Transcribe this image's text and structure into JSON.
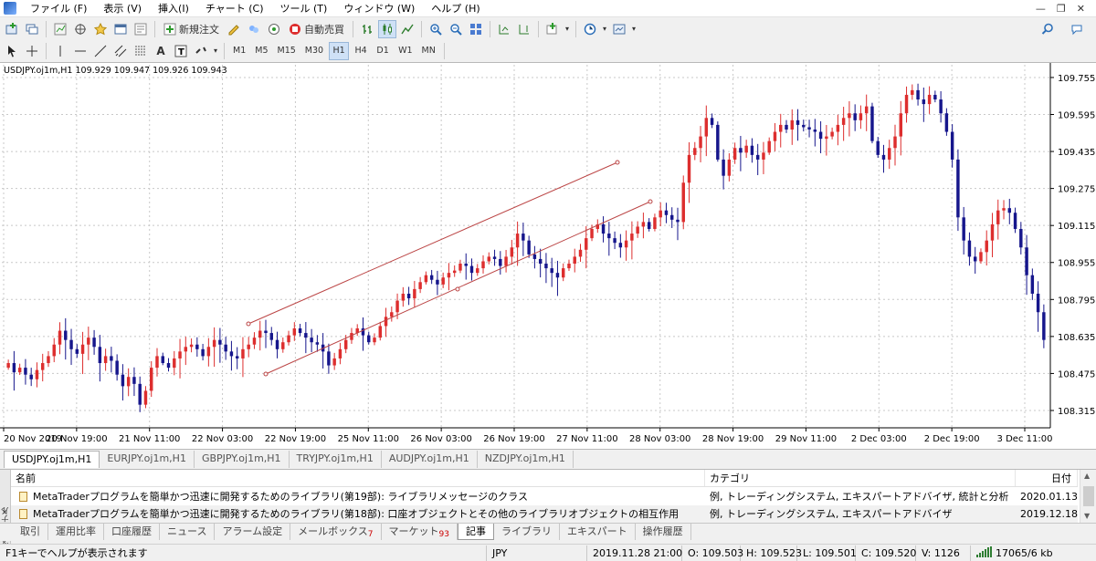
{
  "menu": [
    "ファイル (F)",
    "表示 (V)",
    "挿入(I)",
    "チャート (C)",
    "ツール (T)",
    "ウィンドウ (W)",
    "ヘルプ (H)"
  ],
  "toolbar": {
    "new_order": "新規注文",
    "auto_trade": "自動売買"
  },
  "timeframes": [
    "M1",
    "M5",
    "M15",
    "M30",
    "H1",
    "H4",
    "D1",
    "W1",
    "MN"
  ],
  "active_timeframe": "H1",
  "chart": {
    "label": "USDJPY.oj1m,H1  109.929 109.947 109.926 109.943"
  },
  "chart_data": {
    "type": "candlestick",
    "symbol": "USDJPY.oj1m",
    "timeframe": "H1",
    "ohlc_header": [
      109.929,
      109.947,
      109.926,
      109.943
    ],
    "y_ticks": [
      109.755,
      109.595,
      109.435,
      109.275,
      109.115,
      108.955,
      108.795,
      108.635,
      108.475,
      108.315
    ],
    "x_ticks": [
      "20 Nov 2019",
      "20 Nov 19:00",
      "21 Nov 11:00",
      "22 Nov 03:00",
      "22 Nov 19:00",
      "25 Nov 11:00",
      "26 Nov 03:00",
      "26 Nov 19:00",
      "27 Nov 11:00",
      "28 Nov 03:00",
      "28 Nov 19:00",
      "29 Nov 11:00",
      "2 Dec 03:00",
      "2 Dec 19:00",
      "3 Dec 11:00"
    ],
    "ylim": [
      108.24,
      109.81
    ],
    "bull_color": "#dd2e2e",
    "bear_color": "#16168c",
    "closes": [
      108.52,
      108.48,
      108.5,
      108.47,
      108.45,
      108.49,
      108.52,
      108.55,
      108.6,
      108.66,
      108.62,
      108.58,
      108.56,
      108.6,
      108.63,
      108.59,
      108.52,
      108.55,
      108.53,
      108.47,
      108.42,
      108.46,
      108.43,
      108.34,
      108.4,
      108.5,
      108.55,
      108.52,
      108.5,
      108.54,
      108.57,
      108.59,
      108.6,
      108.58,
      108.55,
      108.59,
      108.62,
      108.6,
      108.57,
      108.55,
      108.54,
      108.58,
      108.6,
      108.63,
      108.66,
      108.65,
      108.62,
      108.58,
      108.61,
      108.64,
      108.67,
      108.65,
      108.63,
      108.61,
      108.6,
      108.57,
      108.51,
      108.54,
      108.58,
      108.62,
      108.65,
      108.67,
      108.64,
      108.61,
      108.63,
      108.68,
      108.72,
      108.74,
      108.79,
      108.82,
      108.8,
      108.84,
      108.87,
      108.9,
      108.88,
      108.86,
      108.89,
      108.91,
      108.92,
      108.95,
      108.94,
      108.91,
      108.93,
      108.96,
      108.98,
      108.97,
      108.94,
      108.98,
      109.02,
      109.08,
      109.05,
      108.99,
      108.97,
      108.95,
      108.93,
      108.91,
      108.89,
      108.93,
      108.95,
      108.98,
      109.01,
      109.06,
      109.1,
      109.12,
      109.08,
      109.06,
      109.04,
      109.02,
      109.05,
      109.08,
      109.11,
      109.13,
      109.1,
      109.15,
      109.18,
      109.16,
      109.14,
      109.13,
      109.3,
      109.42,
      109.45,
      109.5,
      109.58,
      109.55,
      109.4,
      109.33,
      109.4,
      109.45,
      109.43,
      109.46,
      109.42,
      109.4,
      109.43,
      109.48,
      109.52,
      109.55,
      109.53,
      109.57,
      109.55,
      109.54,
      109.53,
      109.52,
      109.49,
      109.5,
      109.52,
      109.55,
      109.58,
      109.6,
      109.57,
      109.6,
      109.63,
      109.48,
      109.42,
      109.4,
      109.45,
      109.5,
      109.6,
      109.68,
      109.7,
      109.66,
      109.64,
      109.68,
      109.66,
      109.6,
      109.52,
      109.4,
      109.15,
      109.05,
      108.98,
      108.96,
      109.0,
      109.05,
      109.12,
      109.18,
      109.19,
      109.17,
      109.1,
      109.02,
      108.9,
      108.82,
      108.74,
      108.62
    ]
  },
  "symbol_tabs": [
    "USDJPY.oj1m,H1",
    "EURJPY.oj1m,H1",
    "GBPJPY.oj1m,H1",
    "TRYJPY.oj1m,H1",
    "AUDJPY.oj1m,H1",
    "NZDJPY.oj1m,H1"
  ],
  "active_symbol_tab": 0,
  "terminal": {
    "side_label": "ターミナル",
    "columns": [
      "名前",
      "カテゴリ",
      "日付"
    ],
    "rows": [
      {
        "name": "MetaTraderプログラムを簡単かつ迅速に開発するためのライブラリ(第19部): ライブラリメッセージのクラス",
        "category": "例, トレーディングシステム, エキスパートアドバイザ, 統計と分析",
        "date": "2020.01.13"
      },
      {
        "name": "MetaTraderプログラムを簡単かつ迅速に開発するためのライブラリ(第18部): 口座オブジェクトとその他のライブラリオブジェクトの相互作用",
        "category": "例, トレーディングシステム, エキスパートアドバイザ",
        "date": "2019.12.18"
      }
    ]
  },
  "bottom_tabs": [
    {
      "label": "取引",
      "badge": ""
    },
    {
      "label": "運用比率",
      "badge": ""
    },
    {
      "label": "口座履歴",
      "badge": ""
    },
    {
      "label": "ニュース",
      "badge": ""
    },
    {
      "label": "アラーム設定",
      "badge": ""
    },
    {
      "label": "メールボックス",
      "badge": "7"
    },
    {
      "label": "マーケット",
      "badge": "93"
    },
    {
      "label": "記事",
      "badge": ""
    },
    {
      "label": "ライブラリ",
      "badge": ""
    },
    {
      "label": "エキスパート",
      "badge": ""
    },
    {
      "label": "操作履歴",
      "badge": ""
    }
  ],
  "active_bottom_tab": 7,
  "status": {
    "help": "F1キーでヘルプが表示されます",
    "currency": "JPY",
    "datetime": "2019.11.28 21:00",
    "open": "O: 109.503",
    "high": "H: 109.523",
    "low": "L: 109.501",
    "close": "C: 109.520",
    "volume": "V: 1126",
    "traffic": "17065/6 kb"
  }
}
